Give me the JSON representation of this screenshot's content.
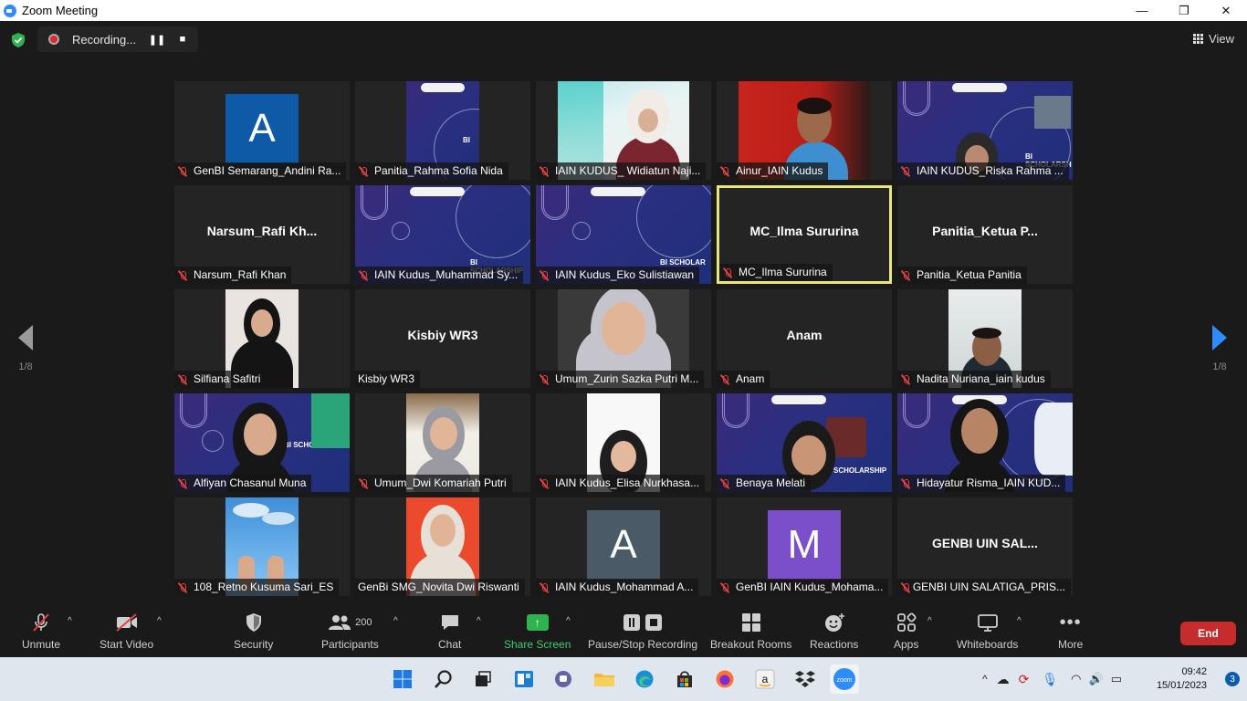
{
  "window": {
    "title": "Zoom Meeting",
    "controls": {
      "minimize": "—",
      "maximize": "❐",
      "close": "✕"
    }
  },
  "recording": {
    "label": "Recording...",
    "pause_icon": "pause-icon",
    "stop_icon": "stop-icon"
  },
  "view": {
    "label": "View"
  },
  "pagination": {
    "left": "1/8",
    "right": "1/8"
  },
  "tiles": [
    {
      "name": "GenBI Semarang_Andini Ra...",
      "type": "avatar",
      "letter": "A",
      "color": "#0e5aa7"
    },
    {
      "name": "Panitia_Rahma Sofia Nida",
      "type": "slide"
    },
    {
      "name": "IAIN KUDUS_ Widiatun Naji...",
      "type": "video"
    },
    {
      "name": "Ainur_IAIN Kudus",
      "type": "video"
    },
    {
      "name": "IAIN KUDUS_Riska Rahma ...",
      "type": "slide"
    },
    {
      "name": "Narsum_Rafi Khan",
      "type": "name",
      "display": "Narsum_Rafi  Kh..."
    },
    {
      "name": "IAIN Kudus_Muhammad Sy...",
      "type": "slide",
      "caption": "BI SCHOLARSHIP"
    },
    {
      "name": "IAIN Kudus_Eko Sulistiawan",
      "type": "slide",
      "caption": "BI SCHOLAR"
    },
    {
      "name": "MC_Ilma Sururina",
      "type": "name",
      "display": "MC_Ilma Sururina",
      "active": true
    },
    {
      "name": "Panitia_Ketua Panitia",
      "type": "name",
      "display": "Panitia_Ketua  P..."
    },
    {
      "name": "Silfiana Safitri",
      "type": "video"
    },
    {
      "name": "Kisbiy WR3",
      "type": "name",
      "display": "Kisbiy WR3",
      "unmuted": true
    },
    {
      "name": "Umum_Zurin Sazka Putri M...",
      "type": "video"
    },
    {
      "name": "Anam",
      "type": "name",
      "display": "Anam"
    },
    {
      "name": "Nadita Nuriana_iain kudus",
      "type": "video"
    },
    {
      "name": "Alfiyan Chasanul Muna",
      "type": "slide",
      "caption": "BI SCHOLARSHIP"
    },
    {
      "name": "Umum_Dwi Komariah Putri",
      "type": "video"
    },
    {
      "name": "IAIN Kudus_Elisa Nurkhasa...",
      "type": "video"
    },
    {
      "name": "Benaya Melati",
      "type": "slide",
      "caption": "SCHOLARSHIP"
    },
    {
      "name": "Hidayatur Risma_IAIN KUD...",
      "type": "slide"
    },
    {
      "name": "108_Retno Kusuma Sari_ES",
      "type": "video"
    },
    {
      "name": "GenBi SMG_Novita Dwi Riswanti",
      "type": "video",
      "unmuted": true
    },
    {
      "name": "IAIN Kudus_Mohammad A...",
      "type": "avatar",
      "letter": "A",
      "color": "#4a5a66"
    },
    {
      "name": "GenBI IAIN Kudus_Mohama...",
      "type": "avatar",
      "letter": "M",
      "color": "#7b4fc9"
    },
    {
      "name": "GENBI UIN SALATIGA_PRIS...",
      "type": "name",
      "display": "GENBI UIN SAL..."
    }
  ],
  "toolbar": {
    "unmute": "Unmute",
    "start_video": "Start Video",
    "security": "Security",
    "participants": "Participants",
    "participants_count": "200",
    "chat": "Chat",
    "share_screen": "Share Screen",
    "pause_stop_recording": "Pause/Stop Recording",
    "breakout_rooms": "Breakout Rooms",
    "reactions": "Reactions",
    "apps": "Apps",
    "whiteboards": "Whiteboards",
    "more": "More",
    "end": "End"
  },
  "taskbar": {
    "time": "09:42",
    "date": "15/01/2023",
    "notifications": "3"
  },
  "colors": {
    "accent": "#2d8cff",
    "end": "#c72c2c",
    "share": "#2fb34f",
    "active_border": "#e8e87a"
  }
}
